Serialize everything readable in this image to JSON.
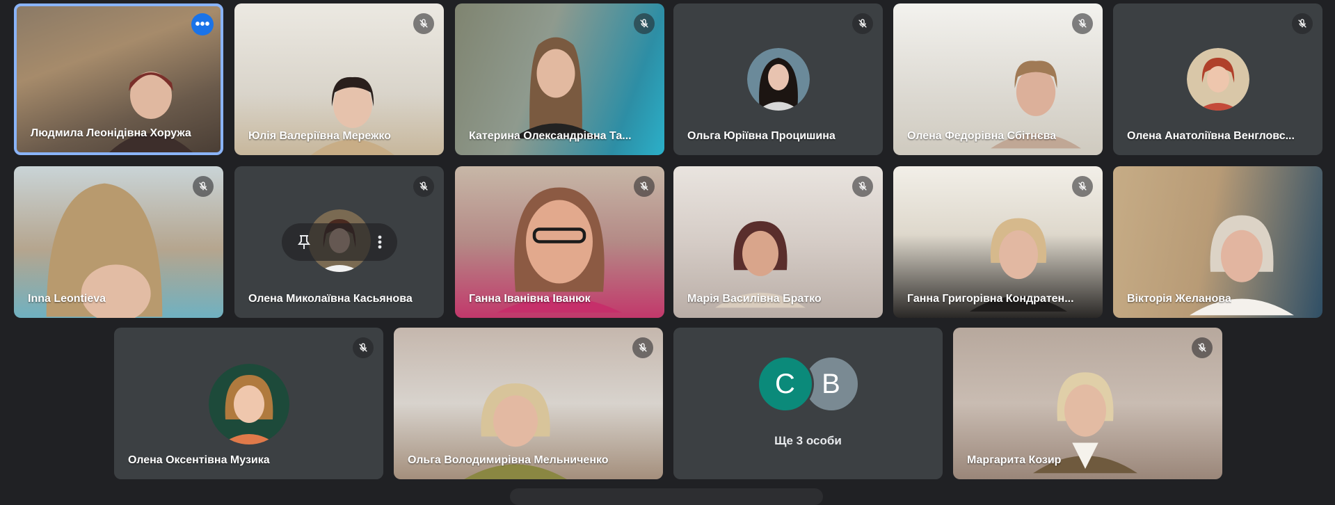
{
  "colors": {
    "background": "#202124",
    "tile": "#3c4043",
    "active_border": "#8ab4f8",
    "more_button": "#1a73e8",
    "avatar_c": "#0b8a7a",
    "avatar_b": "#7a8a93"
  },
  "participants": [
    {
      "name": "Людмила Леонідівна Хоружа",
      "muted": false,
      "active": true,
      "icon": "more-options-icon"
    },
    {
      "name": "Юлія Валеріївна Мережко",
      "muted": true
    },
    {
      "name": "Катерина Олександрівна Та...",
      "muted": true
    },
    {
      "name": "Ольга Юріївна Процишина",
      "muted": true,
      "avatar": "photo"
    },
    {
      "name": "Олена Федорівна Сбітнєва",
      "muted": true
    },
    {
      "name": "Олена Анатоліївна Венгловс...",
      "muted": true,
      "avatar": "photo"
    },
    {
      "name": "Inna Leontieva",
      "muted": true
    },
    {
      "name": "Олена Миколаївна Касьянова",
      "muted": true,
      "avatar": "photo",
      "hover_controls": [
        "pin-icon",
        "more-vert-icon"
      ]
    },
    {
      "name": "Ганна Іванівна Іванюк",
      "muted": true
    },
    {
      "name": "Марія Василівна Братко",
      "muted": true
    },
    {
      "name": "Ганна Григорівна Кондратен...",
      "muted": true
    },
    {
      "name": "Вікторія Желанова",
      "muted": false
    },
    {
      "name": "Олена Оксентівна Музика",
      "muted": true,
      "avatar": "photo"
    },
    {
      "name": "Ольга Володимирівна Мельниченко",
      "muted": true
    },
    {
      "name": "Маргарита Козир",
      "muted": true
    }
  ],
  "more_tile": {
    "letters": [
      "С",
      "В"
    ],
    "label": "Ще 3 особи"
  }
}
